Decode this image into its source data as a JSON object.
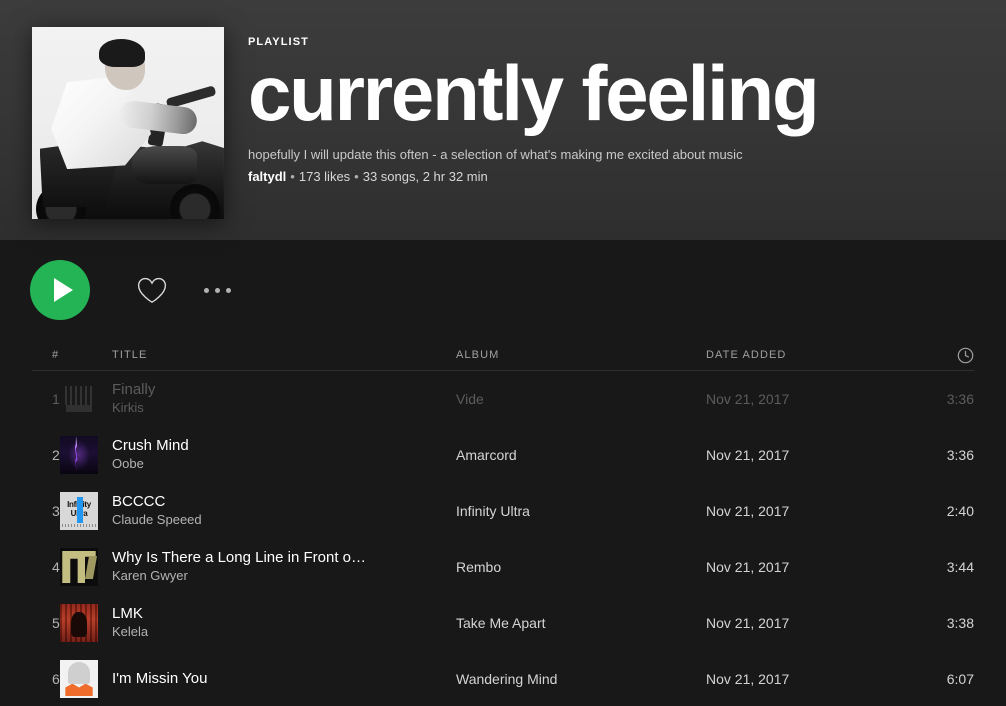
{
  "header": {
    "kind_label": "PLAYLIST",
    "title": "currently feeling",
    "description": "hopefully I will update this often - a selection of what's making me excited about music",
    "owner": "faltydl",
    "likes": "173 likes",
    "songs_summary": "33 songs, 2 hr 32 min",
    "separator": "•",
    "cover_art_name": "black-and-white-photo-of-man-on-motorcycle"
  },
  "actions": {
    "play_label": "Play",
    "like_label": "Save to Your Library",
    "more_label": "More options"
  },
  "table": {
    "columns": {
      "number": "#",
      "title": "TITLE",
      "album": "ALBUM",
      "date_added": "DATE ADDED",
      "duration_icon": "clock-icon"
    },
    "rows": [
      {
        "number": "1",
        "title": "Finally",
        "artist": "Kirkis",
        "album": "Vide",
        "date_added": "Nov 21, 2017",
        "duration": "3:36",
        "art": "art-sketch",
        "dimmed": true
      },
      {
        "number": "2",
        "title": "Crush Mind",
        "artist": "Oobe",
        "album": "Amarcord",
        "date_added": "Nov 21, 2017",
        "duration": "3:36",
        "art": "art-lightning",
        "dimmed": false
      },
      {
        "number": "3",
        "title": "BCCCC",
        "artist": "Claude Speeed",
        "album": "Infinity Ultra",
        "date_added": "Nov 21, 2017",
        "duration": "2:40",
        "art": "art-infinity",
        "dimmed": false
      },
      {
        "number": "4",
        "title": "Why Is There a Long Line in Front o…",
        "artist": "Karen Gwyer",
        "album": "Rembo",
        "date_added": "Nov 21, 2017",
        "duration": "3:44",
        "art": "art-olive",
        "dimmed": false
      },
      {
        "number": "5",
        "title": "LMK",
        "artist": "Kelela",
        "album": "Take Me Apart",
        "date_added": "Nov 21, 2017",
        "duration": "3:38",
        "art": "art-redcurtain",
        "dimmed": false
      },
      {
        "number": "6",
        "title": "I'm Missin You",
        "artist": "",
        "album": "Wandering Mind",
        "date_added": "Nov 21, 2017",
        "duration": "6:07",
        "art": "art-orange",
        "dimmed": false
      }
    ]
  },
  "colors": {
    "accent_green": "#24b455",
    "header_bg": "#383838",
    "body_bg": "#181818",
    "text_secondary": "#b3b3b3",
    "text_dimmed": "#5c5c5c"
  }
}
